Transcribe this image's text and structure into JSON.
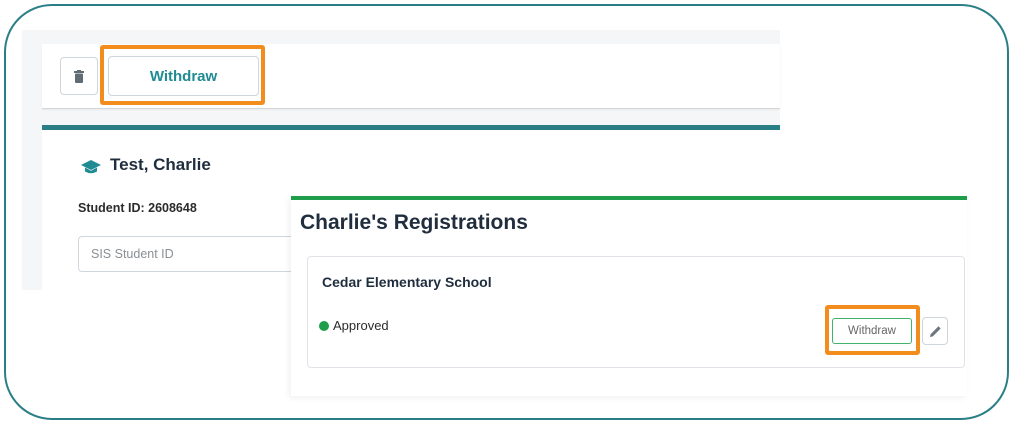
{
  "toolbar": {
    "delete_icon": "trash-icon",
    "withdraw_label": "Withdraw"
  },
  "student": {
    "icon": "graduation-cap-icon",
    "name": "Test, Charlie",
    "id_text": "Student ID: 2608648",
    "sis_placeholder": "SIS Student ID"
  },
  "registrations": {
    "title": "Charlie's Registrations",
    "school": "Cedar Elementary School",
    "status": "Approved",
    "withdraw_label": "Withdraw",
    "edit_icon": "pencil-icon"
  },
  "colors": {
    "teal": "#2a7f86",
    "green": "#1e9e4a",
    "highlight": "#f28c1c"
  }
}
